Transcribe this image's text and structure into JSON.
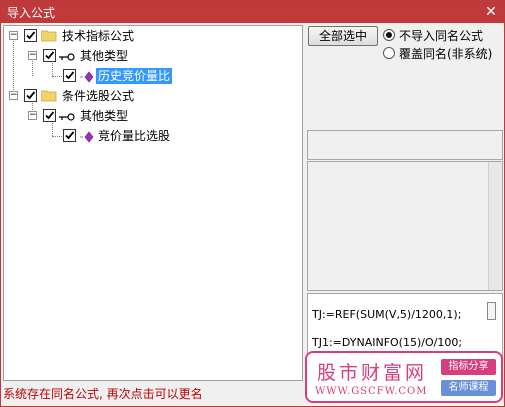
{
  "window": {
    "title": "导入公式",
    "close_label": "✕"
  },
  "tree": {
    "nodes": [
      {
        "label": "技术指标公式",
        "expander": "−"
      },
      {
        "label": "其他类型",
        "expander": "−"
      },
      {
        "label": "历史竞价量比"
      },
      {
        "label": "条件选股公式",
        "expander": "−"
      },
      {
        "label": "其他类型",
        "expander": "−"
      },
      {
        "label": "竞价量比选股"
      }
    ]
  },
  "controls": {
    "select_all_label": "全部选中",
    "radio_options": [
      {
        "label": "不导入同名公式",
        "selected": true
      },
      {
        "label": "覆盖同名(非系统)",
        "selected": false
      }
    ]
  },
  "code": {
    "lines": [
      "TJ:=REF(SUM(V,5)/1200,1);",
      "TJ1:=DYNAINFO(15)/O/100;"
    ]
  },
  "status": {
    "message": "系统存在同名公式, 再次点击可以更名"
  },
  "watermark": {
    "brand": "股市财富网",
    "url": "WWW.GSCFW.COM",
    "tag1": "指标分享",
    "tag2": "名师课程",
    "color": "#d63e7d"
  }
}
